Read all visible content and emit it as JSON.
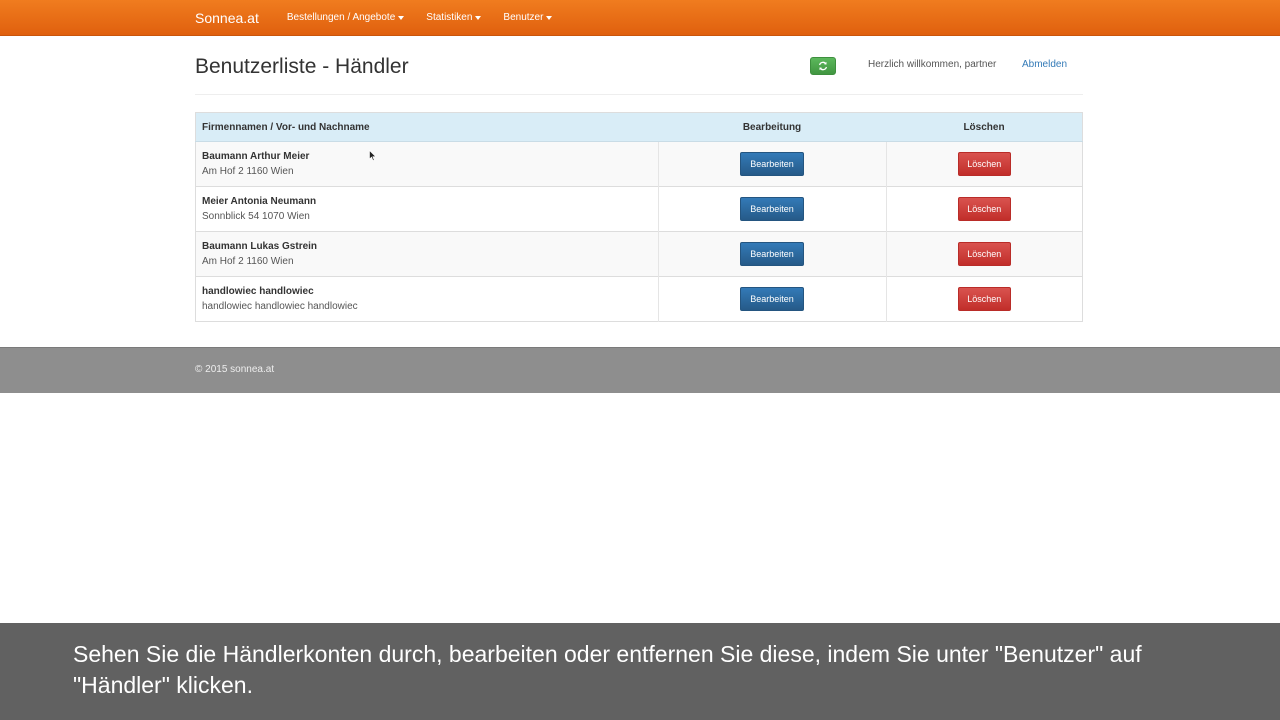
{
  "nav": {
    "brand": "Sonnea.at",
    "items": [
      {
        "label": "Bestellungen / Angebote"
      },
      {
        "label": "Statistiken"
      },
      {
        "label": "Benutzer"
      }
    ]
  },
  "header": {
    "title": "Benutzerliste - Händler",
    "welcome": "Herzlich willkommen, partner",
    "logout": "Abmelden"
  },
  "table": {
    "columns": [
      "Firmennamen / Vor- und Nachname",
      "Bearbeitung",
      "Löschen"
    ],
    "edit_label": "Bearbeiten",
    "delete_label": "Löschen",
    "rows": [
      {
        "name": "Baumann Arthur Meier",
        "address": "Am Hof 2 1160 Wien"
      },
      {
        "name": "Meier Antonia Neumann",
        "address": "Sonnblick 54 1070 Wien"
      },
      {
        "name": "Baumann Lukas Gstrein",
        "address": "Am Hof 2 1160 Wien"
      },
      {
        "name": "handlowiec handlowiec",
        "address": "handlowiec handlowiec handlowiec"
      }
    ]
  },
  "footer": {
    "text": "© 2015 sonnea.at"
  },
  "caption": {
    "text": "Sehen Sie die Händlerkonten durch, bearbeiten oder entfernen Sie diese, indem Sie unter \"Benutzer\" auf \"Händler\" klicken."
  },
  "colors": {
    "navbar": "#e8701a",
    "primary": "#337ab7",
    "danger": "#d9534f",
    "success": "#5cb85c",
    "table_header": "#d9edf7",
    "footer": "#8e8e8e",
    "caption": "#616161"
  },
  "icons": {
    "refresh": "refresh-icon",
    "caret": "caret-down-icon",
    "cursor": "mouse-pointer-icon"
  }
}
